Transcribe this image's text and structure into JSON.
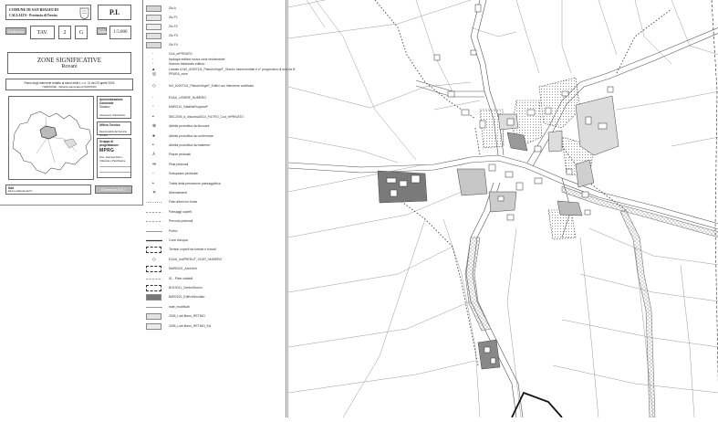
{
  "title_block": {
    "municipality": "COMUNE DI SAN BIAGIO DI",
    "municipality2": "CALLALTA - Provincia di Treviso",
    "plan": "P.I.",
    "elaborato_label": "Elaborato",
    "tav_label": "TAV.",
    "tav_number": "2",
    "tav_letter": "G",
    "scale_label": "Scala",
    "scale": "1:5.000",
    "zone_title": "ZONE SIGNIFICATIVE",
    "zone_name": "Rovarè",
    "intervention_line1": "Piano degli interventi redatto ai sensi della L.r. n. 11 del 23 aprile 2004",
    "intervention_line2": "(VERSIONE - Variante approvata al 2015/2016)",
    "admin_header": "Amministrazione Comunale",
    "admin_sindaco": "Sindaco",
    "admin_assessore": "Assessore Urbanistica",
    "office_header": "Ufficio Tecnico",
    "office_resp": "Responsabile del Servizio Tecnico",
    "design_header": "Gruppo di progettazione",
    "design_firm": "MPRG",
    "design_names": "Pian. Gianluca Ramo - Urbanista e Pianificatore",
    "doc_code": "Ddd",
    "doc_subtitle": "Elenco elaborati del P.I.",
    "date": "Dicembre 2017"
  },
  "legend": [
    {
      "label": "Zto A",
      "swatch": "#d6d6d6",
      "kind": "fill"
    },
    {
      "label": "Zto F1",
      "swatch": "#e6e6e6",
      "kind": "fill"
    },
    {
      "label": "Zto F2",
      "swatch": "#eeeeee",
      "kind": "fill"
    },
    {
      "label": "Zto F3",
      "swatch": "#e2e2e2",
      "kind": "fill"
    },
    {
      "label": "Zto F4",
      "swatch": "#d9d9d9",
      "kind": "fill"
    },
    {
      "label": "Civil_rePRIVATO",
      "swatch": "",
      "kind": "icon",
      "icon": "·"
    },
    {
      "label": "tipologia edilizia nuova zona residenziale",
      "swatch": "",
      "kind": "icon",
      "icon": "·"
    },
    {
      "label": "Numero fabbricato edificio",
      "swatch": "",
      "kind": "icon",
      "icon": "·"
    },
    {
      "label": "Latoato A NO_d2007111_PianoInVegeF_Vincolo monumentale e n° progressivo di scheda B",
      "swatch": "",
      "kind": "icon",
      "icon": "▴"
    },
    {
      "label": "PRUEA_zone",
      "swatch": "",
      "kind": "icon",
      "icon": "◎"
    },
    {
      "label": "NO_b2007111_PianoInVegeF_Edifici con intervento codificato",
      "swatch": "",
      "kind": "icon",
      "icon": "◇"
    },
    {
      "label": "EXAU_USIHRE_NUMERO",
      "swatch": "",
      "kind": "icon",
      "icon": "·"
    },
    {
      "label": "MARO10_ViabilitaProgramP",
      "swatch": "",
      "kind": "icon",
      "icon": "▫"
    },
    {
      "label": "SBC2005_a_discinbui2014_FILTRO_Cod_rePRIVATO",
      "swatch": "",
      "kind": "icon",
      "icon": "▪"
    },
    {
      "label": "Attività produttiva da bloccare",
      "swatch": "",
      "kind": "icon",
      "icon": "⊗"
    },
    {
      "label": "Attività produttiva da confermare",
      "swatch": "",
      "kind": "icon",
      "icon": "●"
    },
    {
      "label": "Attività produttiva da trasferire",
      "swatch": "",
      "kind": "icon",
      "icon": "•"
    },
    {
      "label": "Piazze pedonali",
      "swatch": "",
      "kind": "icon",
      "icon": "⅄"
    },
    {
      "label": "Piste pedonali",
      "swatch": "",
      "kind": "icon",
      "icon": "⇹"
    },
    {
      "label": "Sottopasso pedonale",
      "swatch": "",
      "kind": "icon",
      "icon": "◦"
    },
    {
      "label": "Tutela della percezione paesaggistica",
      "swatch": "",
      "kind": "icon",
      "icon": "▪"
    },
    {
      "label": "Alberaamenti",
      "swatch": "",
      "kind": "icon",
      "icon": "✕"
    },
    {
      "label": "Filari alberi e/o fosse",
      "swatch": "",
      "kind": "line-dots"
    },
    {
      "label": "Paesaggi coperti",
      "swatch": "",
      "kind": "line-dash"
    },
    {
      "label": "Percorsi pedonali",
      "swatch": "",
      "kind": "line-dash"
    },
    {
      "label": "Portici",
      "swatch": "",
      "kind": "line-thin"
    },
    {
      "label": "Corsi d'acqua",
      "swatch": "",
      "kind": "line-thick"
    },
    {
      "label": "Territori coperti da foreste e boschi",
      "swatch": "#ffffff",
      "kind": "dashbox"
    },
    {
      "label": "EXAU_InaPREDUT_V1187_NUMERO",
      "swatch": "",
      "kind": "icon",
      "icon": "◇"
    },
    {
      "label": "MARD021_AreeUnit",
      "swatch": "#ffffff",
      "kind": "dashbox"
    },
    {
      "label": "01 - Piste ciclabili",
      "swatch": "",
      "kind": "line-dash"
    },
    {
      "label": "BO10011_CentroStorico",
      "swatch": "#ffffff",
      "kind": "dashbox"
    },
    {
      "label": "BAR2021_EdificiVincolato",
      "swatch": "#777777",
      "kind": "fill"
    },
    {
      "label": "hate_modificati",
      "swatch": "",
      "kind": "line-thin"
    },
    {
      "label": "2005_Lotti libero_RETINO",
      "swatch": "#e2e2e2",
      "kind": "fill"
    },
    {
      "label": "2005_Lotti libero_RETINO_EA",
      "swatch": "#eaeaea",
      "kind": "fill"
    }
  ]
}
